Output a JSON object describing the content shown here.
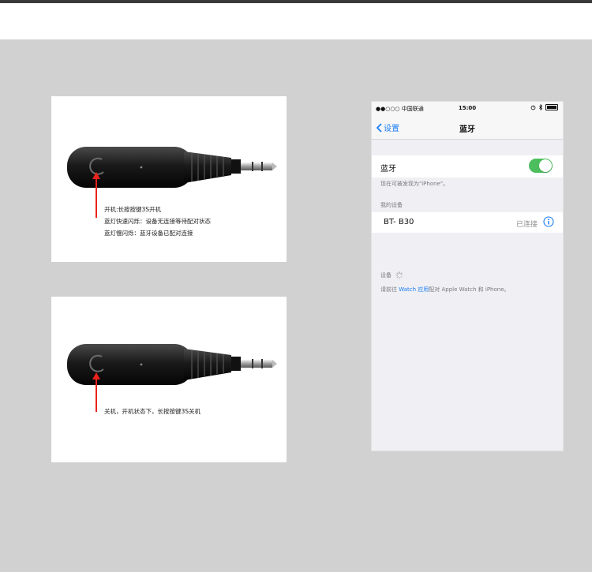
{
  "card1": {
    "lines": [
      "开机:长按按键3S开机",
      "蓝灯快速闪烁：设备无连接等待配对状态",
      "蓝灯慢闪烁：蓝牙设备已配对连接"
    ]
  },
  "card2": {
    "lines": [
      "关机，开机状态下，长按按键3S关机"
    ]
  },
  "phone": {
    "status": {
      "carrier": "●●○○○ 中国联通",
      "time": "15:00"
    },
    "nav": {
      "back_label": "设置",
      "title": "蓝牙"
    },
    "bluetooth": {
      "label": "蓝牙",
      "enabled": true,
      "accent": "#4cbe5e"
    },
    "discoverable_text": "现在可被发现为\"iPhone\"。",
    "my_devices_header": "我的设备",
    "device": {
      "name": "BT- B30",
      "status": "已连接"
    },
    "devices_header": "设备",
    "pair_hint": {
      "prefix": "请前往 ",
      "link": "Watch 应用",
      "suffix": "配对 Apple Watch 和 iPhone。"
    },
    "link_color": "#1a7cf5"
  }
}
